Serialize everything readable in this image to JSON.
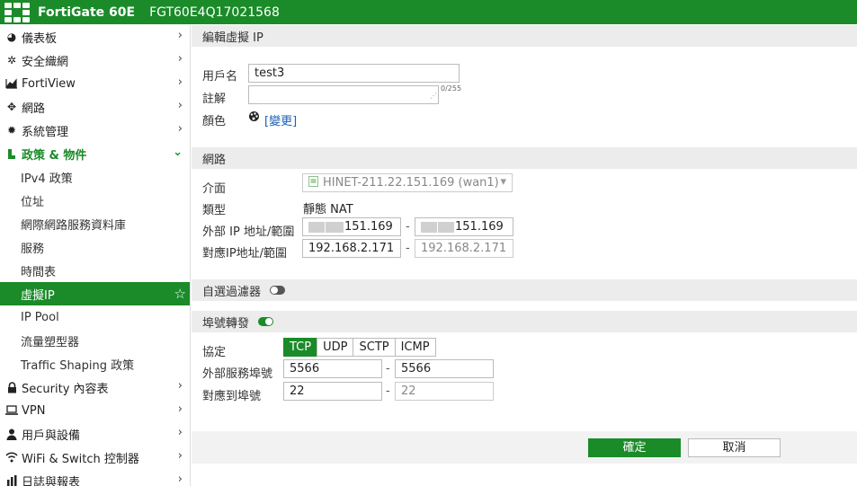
{
  "header": {
    "product": "FortiGate 60E",
    "serial": "FGT60E4Q17021568",
    "bg_color": "#1a8b28"
  },
  "sidebar": {
    "items": [
      {
        "label": "儀表板",
        "icon": "dashboard-icon"
      },
      {
        "label": "安全織網",
        "icon": "fabric-icon"
      },
      {
        "label": "FortiView",
        "icon": "chart-icon"
      },
      {
        "label": "網路",
        "icon": "network-icon"
      },
      {
        "label": "系統管理",
        "icon": "gear-icon"
      },
      {
        "label": "政策 & 物件",
        "icon": "policy-icon",
        "expanded": true
      }
    ],
    "sub_items": [
      {
        "label": "IPv4 政策"
      },
      {
        "label": "位址"
      },
      {
        "label": "網際網路服務資料庫"
      },
      {
        "label": "服務"
      },
      {
        "label": "時間表"
      },
      {
        "label": "虛擬IP",
        "active": true
      },
      {
        "label": "IP Pool"
      },
      {
        "label": "流量塑型器"
      },
      {
        "label": "Traffic Shaping 政策"
      }
    ],
    "items_after": [
      {
        "label": "Security 內容表",
        "icon": "lock-icon"
      },
      {
        "label": "VPN",
        "icon": "monitor-icon"
      },
      {
        "label": "用戶與設備",
        "icon": "user-icon"
      },
      {
        "label": "WiFi & Switch 控制器",
        "icon": "wifi-icon"
      },
      {
        "label": "日誌與報表",
        "icon": "report-icon"
      }
    ]
  },
  "form": {
    "title": "編輯虛擬 IP",
    "name_label": "用戶名",
    "name_value": "test3",
    "comment_label": "註解",
    "comment_counter": "0/255",
    "color_label": "顏色",
    "color_change": "[變更]",
    "network_section": "網路",
    "interface_label": "介面",
    "interface_value": "HINET-211.22.151.169 (wan1)",
    "type_label": "類型",
    "type_value": "靜態 NAT",
    "ext_ip_label": "外部 IP 地址/範圍",
    "ext_ip_from": "151.169",
    "ext_ip_to": "151.169",
    "mapped_ip_label": "對應IP地址/範圍",
    "mapped_ip_from": "192.168.2.171",
    "mapped_ip_to": "192.168.2.171",
    "filter_label": "自選過濾器",
    "filter_enabled": false,
    "port_fwd_label": "埠號轉發",
    "port_fwd_enabled": true,
    "protocol_label": "協定",
    "protocols": [
      "TCP",
      "UDP",
      "SCTP",
      "ICMP"
    ],
    "protocol_selected": "TCP",
    "ext_port_label": "外部服務埠號",
    "ext_port_from": "5566",
    "ext_port_to": "5566",
    "map_port_label": "對應到埠號",
    "map_port_from": "22",
    "map_port_to": "22",
    "ok_label": "確定",
    "cancel_label": "取消"
  }
}
